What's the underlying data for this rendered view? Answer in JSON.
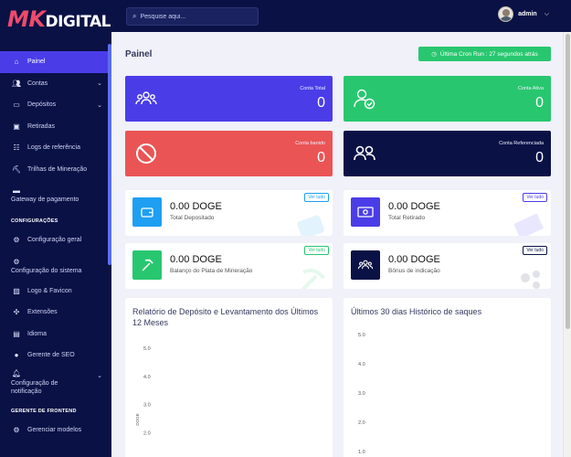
{
  "logo": {
    "mk": "MK",
    "rest": "DIGITAL"
  },
  "header": {
    "search_placeholder": "Pesquise aqui...",
    "user_name": "admin"
  },
  "sidebar": {
    "items": [
      {
        "label": "Painel",
        "icon": "home-icon",
        "active": true
      },
      {
        "label": "Contas",
        "icon": "users-icon",
        "chevron": true
      },
      {
        "label": "Depósitos",
        "icon": "wallet-icon",
        "chevron": true
      },
      {
        "label": "Retiradas",
        "icon": "money-icon"
      },
      {
        "label": "Logs de referência",
        "icon": "group-icon"
      },
      {
        "label": "Trilhas de Mineração",
        "icon": "pickaxe-icon"
      },
      {
        "label": "Gateway de pagamento",
        "icon": "card-icon"
      }
    ],
    "section_config": "CONFIGURAÇÕES",
    "config_items": [
      {
        "label": "Configuração geral",
        "icon": "gear-icon"
      },
      {
        "label": "Configuração do sistema",
        "icon": "gears-icon"
      },
      {
        "label": "Logo & Favicon",
        "icon": "image-icon"
      },
      {
        "label": "Extensões",
        "icon": "puzzle-icon"
      },
      {
        "label": "Idioma",
        "icon": "language-icon"
      },
      {
        "label": "Gerente de SEO",
        "icon": "globe-icon"
      },
      {
        "label": "Configuração de notificação",
        "icon": "bell-icon",
        "chevron": true
      }
    ],
    "section_frontend": "GERENTE DE FRONTEND",
    "frontend_items": [
      {
        "label": "Gerenciar modelos",
        "icon": "gear-icon"
      }
    ]
  },
  "main": {
    "title": "Painel",
    "cron_label": "Última Cron Run : 27 segundos atrás",
    "stats": [
      {
        "label": "Conta Total",
        "value": "0",
        "color": "#4a3de8",
        "icon": "users-icon"
      },
      {
        "label": "Conta Ativa",
        "value": "0",
        "color": "#28c76f",
        "icon": "user-check-icon"
      },
      {
        "label": "Conta banido",
        "value": "0",
        "color": "#ea5455",
        "icon": "ban-icon"
      },
      {
        "label": "Conta Referenciada",
        "value": "0",
        "color": "#0a1145",
        "icon": "user-friends-icon"
      }
    ],
    "cards": [
      {
        "value": "0.00 DOGE",
        "label": "Total Depositado",
        "tag": "Ver tudo",
        "color": "#1e9ff2",
        "tag_color": "#1e9ff2",
        "icon": "wallet-icon"
      },
      {
        "value": "0.00 DOGE",
        "label": "Total Retirado",
        "tag": "Ver tudo",
        "color": "#4a3de8",
        "tag_color": "#4a3de8",
        "icon": "money-bill-icon"
      },
      {
        "value": "0.00 DOGE",
        "label": "Balanço do Plata de Mineração",
        "tag": "Ver tudo",
        "color": "#28c76f",
        "tag_color": "#28c76f",
        "icon": "pickaxe-icon"
      },
      {
        "value": "0.00 DOGE",
        "label": "Bônus de indicação",
        "tag": "Ver tudo",
        "color": "#0a1145",
        "tag_color": "#0a1145",
        "icon": "users-icon"
      }
    ],
    "charts": {
      "left_title": "Relatório de Depósito e Levantamento dos Últimos 12 Meses",
      "right_title": "Últimos 30 dias Histórico de saques"
    }
  },
  "chart_data": [
    {
      "type": "bar",
      "title": "Relatório de Depósito e Levantamento dos Últimos 12 Meses",
      "ylabel": "DOGE",
      "yticks": [
        "5.0",
        "4.0",
        "3.0",
        "2.0"
      ],
      "ylim": [
        1,
        5
      ],
      "series": []
    },
    {
      "type": "line",
      "title": "Últimos 30 dias Histórico de saques",
      "yticks": [
        "5.0",
        "4.0",
        "3.0",
        "2.0",
        "1.0"
      ],
      "ylim": [
        0,
        5
      ],
      "series": []
    }
  ]
}
